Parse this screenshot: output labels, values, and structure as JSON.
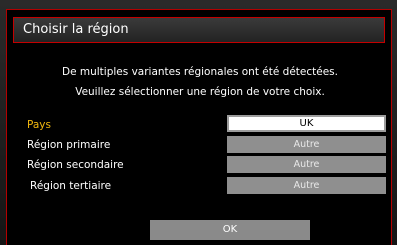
{
  "dialog": {
    "title": "Choisir la région",
    "message_line1": "De multiples variantes régionales ont été détectées.",
    "message_line2": "Veuillez sélectionner une région de votre choix."
  },
  "fields": [
    {
      "label": "Pays",
      "value": "UK"
    },
    {
      "label": "Région primaire",
      "value": "Autre"
    },
    {
      "label": "Région secondaire",
      "value": "Autre"
    },
    {
      "label": "Région tertiaire",
      "value": "Autre"
    }
  ],
  "ok_label": "OK",
  "colors": {
    "accent_border": "#c40000",
    "active_label": "#f2b80e",
    "selected_value_bg": "#ffffff",
    "value_bg": "#8f8f8f"
  }
}
